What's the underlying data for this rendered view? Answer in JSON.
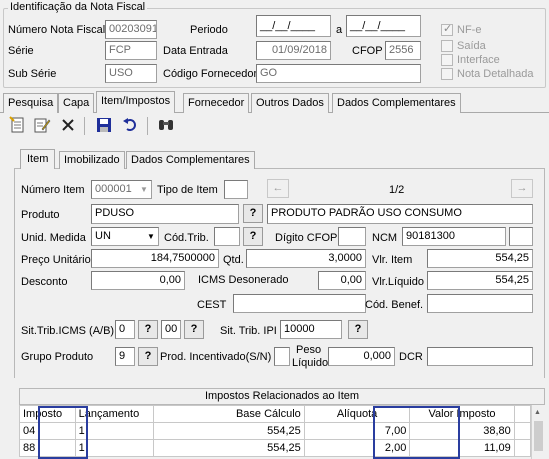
{
  "header": {
    "legend": "Identificação da Nota Fiscal",
    "numero_label": "Número Nota Fiscal",
    "numero_value": "002030918",
    "periodo_label": "Periodo",
    "periodo_start": "__/__/____",
    "periodo_a": "a",
    "periodo_end": "__/__/____",
    "serie_label": "Série",
    "serie_value": "FCP",
    "data_entrada_label": "Data Entrada",
    "data_entrada_value": "01/09/2018",
    "cfop_label": "CFOP",
    "cfop_value": "2556",
    "subserie_label": "Sub Série",
    "subserie_value": "USO",
    "cod_fornecedor_label": "Código Fornecedor",
    "cod_fornecedor_value": "GO",
    "checkboxes": [
      "NF-e",
      "Saída",
      "Interface",
      "Nota Detalhada"
    ],
    "checked": [
      true,
      false,
      false,
      false
    ]
  },
  "main_tabs": [
    "Pesquisa",
    "Capa",
    "Item/Impostos",
    "Fornecedor",
    "Outros Dados",
    "Dados Complementares"
  ],
  "toolbar_icons": [
    "new-document-icon",
    "edit-icon",
    "delete-icon",
    "save-icon",
    "undo-icon",
    "binoculars-icon"
  ],
  "sub_tabs": [
    "Item",
    "Imobilizado",
    "Dados Complementares"
  ],
  "item": {
    "numero_item_label": "Número Item",
    "numero_item_value": "000001",
    "tipo_item_label": "Tipo de Item",
    "tipo_item_value": "",
    "nav_left": "←",
    "nav_right": "→",
    "page_counter": "1/2",
    "produto_label": "Produto",
    "produto_code": "PDUSO",
    "produto_desc": "PRODUTO PADRÃO USO CONSUMO",
    "unid_label": "Unid. Medida",
    "unid_value": "UN",
    "cod_trib_label": "Cód.Trib.",
    "cod_trib_value": "",
    "digito_cfop_label": "Dígito CFOP",
    "digito_cfop_value": "",
    "ncm_label": "NCM",
    "ncm_value": "90181300",
    "ncm_extra": "",
    "preco_label": "Preço Unitário",
    "preco_value": "184,7500000",
    "qtd_label": "Qtd.",
    "qtd_value": "3,0000",
    "vlr_item_label": "Vlr. Item",
    "vlr_item_value": "554,25",
    "desconto_label": "Desconto",
    "desconto_value": "0,00",
    "icms_deson_label": "ICMS Desonerado",
    "icms_deson_value": "0,00",
    "vlr_liquido_label": "Vlr.Líquido",
    "vlr_liquido_value": "554,25",
    "cest_label": "CEST",
    "cest_value": "",
    "cod_benef_label": "Cód. Benef.",
    "cod_benef_value": "",
    "sit_icms_label": "Sit.Trib.ICMS (A/B)",
    "sit_icms_a": "0",
    "sit_icms_b": "00",
    "sit_ipi_label": "Sit. Trib. IPI",
    "sit_ipi_value": "10000",
    "grupo_label": "Grupo Produto",
    "grupo_value": "9",
    "prod_incent_label": "Prod. Incentivado(S/N)",
    "peso_label_1": "Peso",
    "peso_label_2": "Líquido",
    "peso_value": "0,000",
    "dcr_label": "DCR",
    "dcr_value": "",
    "q_button": "?"
  },
  "impostos": {
    "title": "Impostos Relacionados ao Item",
    "columns": [
      "Imposto",
      "Lançamento",
      "Base Cálculo",
      "Alíquota",
      "Valor Imposto"
    ],
    "rows": [
      [
        "04",
        "1",
        "554,25",
        "7,00",
        "38,80"
      ],
      [
        "88",
        "1",
        "554,25",
        "2,00",
        "11,09"
      ]
    ]
  }
}
